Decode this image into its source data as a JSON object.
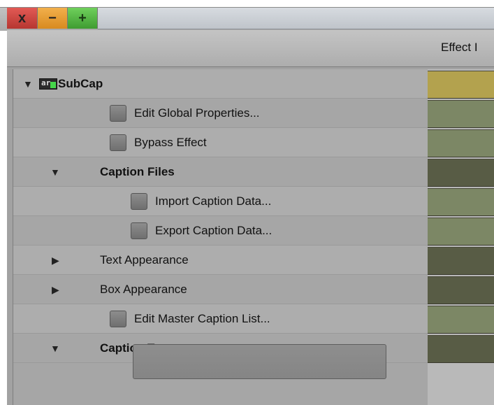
{
  "window": {
    "close_label": "x",
    "minimize_label": "−",
    "maximize_label": "+"
  },
  "header": {
    "column_title": "Effect I"
  },
  "tree": {
    "root": {
      "label": "SubCap",
      "icon": "subcap-plugin-icon"
    },
    "items": [
      {
        "label": "Edit Global Properties...",
        "type": "checkbox"
      },
      {
        "label": "Bypass Effect",
        "type": "checkbox"
      },
      {
        "label": "Caption Files",
        "type": "group-expanded"
      },
      {
        "label": "Import Caption Data...",
        "type": "checkbox"
      },
      {
        "label": "Export Caption Data...",
        "type": "checkbox"
      },
      {
        "label": "Text Appearance",
        "type": "group-collapsed"
      },
      {
        "label": "Box Appearance",
        "type": "group-collapsed"
      },
      {
        "label": "Edit Master Caption List...",
        "type": "checkbox"
      },
      {
        "label": "Caption Text",
        "type": "group-expanded"
      }
    ],
    "caption_text_value": ""
  },
  "colors": {
    "keyframe_selected": "#b3a24e",
    "keyframe_light": "#7c8765",
    "keyframe_dark": "#585c45"
  }
}
